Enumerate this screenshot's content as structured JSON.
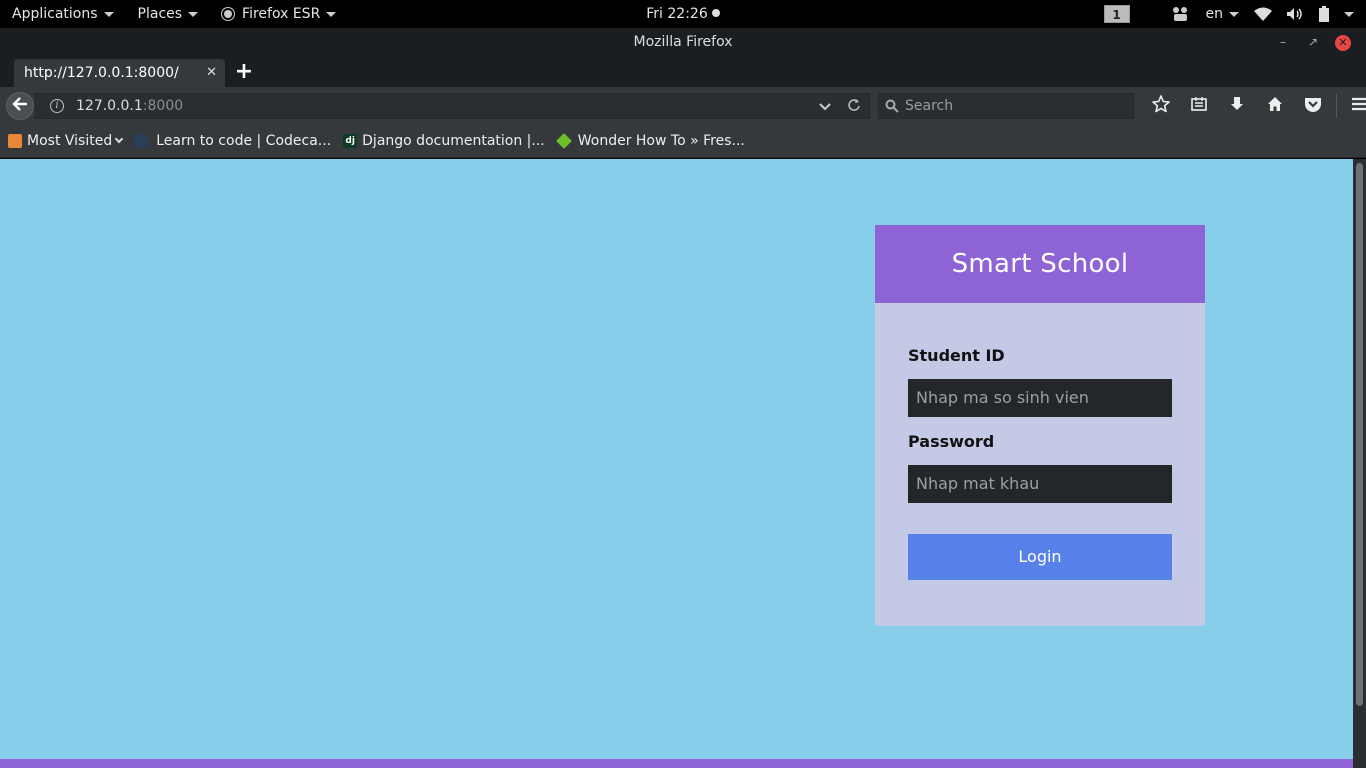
{
  "topbar": {
    "applications": "Applications",
    "places": "Places",
    "app_menu": "Firefox ESR",
    "clock": "Fri 22:26",
    "workspace": "1",
    "language": "en"
  },
  "window": {
    "title": "Mozilla Firefox"
  },
  "tabs": [
    {
      "label": "http://127.0.0.1:8000/"
    }
  ],
  "navbar": {
    "url_host": "127.0.0.1",
    "url_port": ":8000",
    "search_placeholder": "Search"
  },
  "bookmarks": [
    {
      "label": "Most Visited",
      "icon": "folder-icon"
    },
    {
      "label": "Learn to code | Codeca...",
      "icon": "codecademy-icon"
    },
    {
      "label": "Django documentation |...",
      "icon": "django-icon"
    },
    {
      "label": "Wonder How To » Fres...",
      "icon": "wonderhowto-icon"
    }
  ],
  "bookmark_icons": {
    "django": "dj"
  },
  "login": {
    "title": "Smart School",
    "student_id_label": "Student ID",
    "student_id_placeholder": "Nhap ma so sinh vien",
    "password_label": "Password",
    "password_placeholder": "Nhap mat khau",
    "login_button": "Login"
  },
  "colors": {
    "page_background": "#87ceeb",
    "card_header": "#8e63d6",
    "card_body": "#c4cae6",
    "input_background": "#232729",
    "login_button": "#5780e8"
  }
}
